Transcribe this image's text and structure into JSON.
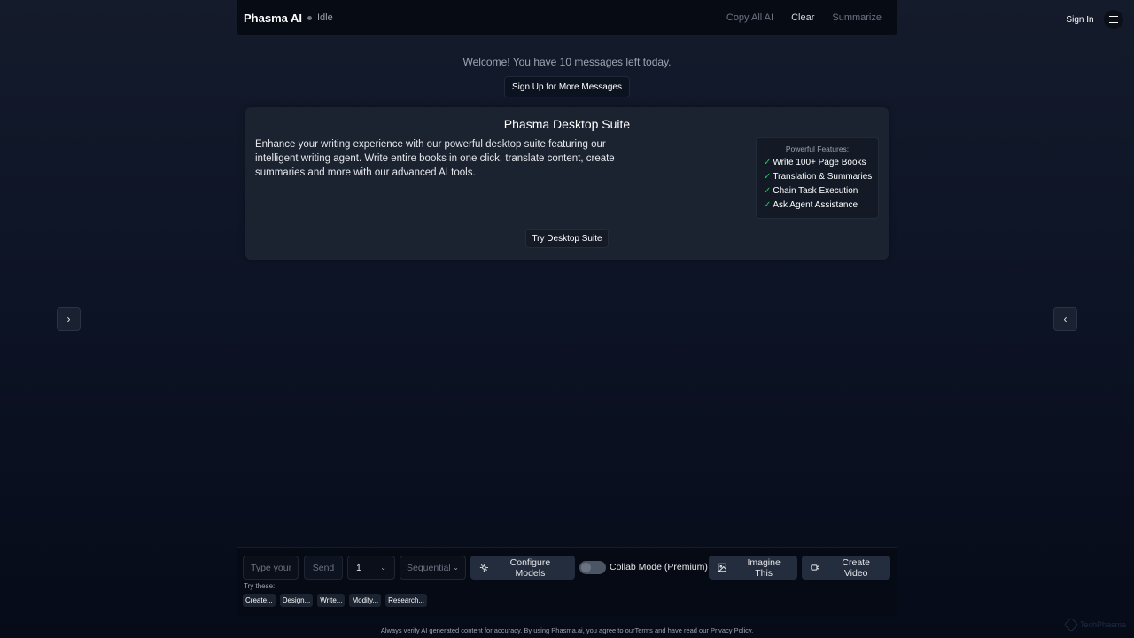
{
  "header": {
    "brand": "Phasma AI",
    "status": "Idle",
    "actions": [
      "Copy All AI",
      "Clear",
      "Summarize"
    ],
    "sign_in": "Sign In"
  },
  "welcome": {
    "message": "Welcome! You have 10 messages left today.",
    "signup_button": "Sign Up for More Messages"
  },
  "promo": {
    "title": "Phasma Desktop Suite",
    "description": "Enhance your writing experience with our powerful desktop suite featuring our intelligent writing agent. Write entire books in one click, translate content, create summaries and more with our advanced AI tools.",
    "features_heading": "Powerful Features:",
    "check_mark": "✓",
    "features": [
      "Write 100+ Page Books",
      "Translation & Summaries",
      "Chain Task Execution",
      "Ask Agent Assistance"
    ],
    "cta": "Try Desktop Suite"
  },
  "nav": {
    "left_arrow": "›",
    "right_arrow": "‹"
  },
  "composer": {
    "input_placeholder": "Type your",
    "send": "Send",
    "count_value": "1",
    "mode_value": "Sequential",
    "configure_models": "Configure Models",
    "collab_mode": "Collab Mode (Premium)",
    "collab_enabled": false,
    "imagine": "Imagine This",
    "create_video": "Create Video",
    "try_these_label": "Try these:",
    "suggestions": [
      "Create...",
      "Design...",
      "Write...",
      "Modify...",
      "Research..."
    ]
  },
  "footer": {
    "prefix": "Always verify AI generated content for accuracy. By using Phasma.ai, you agree to our",
    "terms": "Terms",
    "middle": " and have read our ",
    "privacy": "Privacy Policy",
    "suffix": "."
  },
  "watermark": "TechPhasma",
  "colors": {
    "check": "#22c55e",
    "button_bg": "#242d3d",
    "panel_bg": "#1b2230"
  }
}
